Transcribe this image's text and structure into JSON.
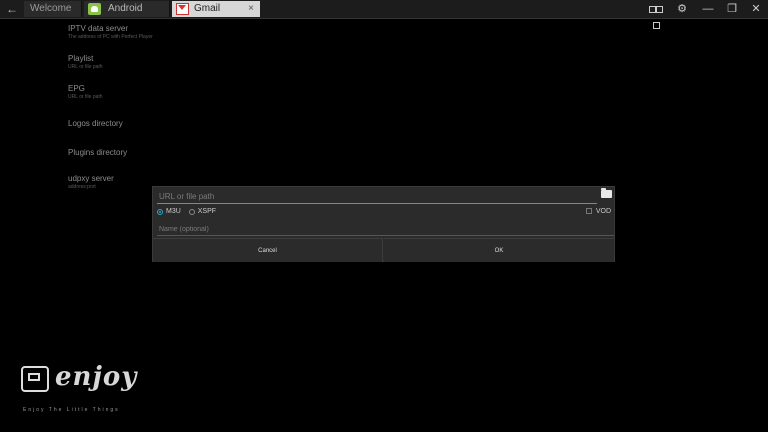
{
  "titlebar": {
    "tabs": [
      {
        "label": "Welcome"
      },
      {
        "label": "Android"
      },
      {
        "label": "Gmail",
        "close": "×"
      }
    ],
    "back": "←",
    "icons": {
      "gear": "⚙",
      "minimize": "—",
      "restore": "❐",
      "close": "✕"
    }
  },
  "settings": [
    {
      "title": "IPTV data server",
      "sub": "The address of PC with Perfect Player"
    },
    {
      "title": "Playlist",
      "sub": "URL or file path"
    },
    {
      "title": "EPG",
      "sub": "URL or file path"
    },
    {
      "title": "Logos directory",
      "sub": ""
    },
    {
      "title": "Plugins directory",
      "sub": ""
    },
    {
      "title": "udpxy server",
      "sub": "address:port"
    }
  ],
  "dialog": {
    "url_placeholder": "URL or file path",
    "radio_m3u": "M3U",
    "radio_xspf": "XSPF",
    "vod_label": "VOD",
    "name_placeholder": "Name (optional)",
    "cancel_label": "Cancel",
    "ok_label": "OK",
    "accent_color": "#2aa8c7"
  },
  "watermark": {
    "brand": "enjoy",
    "tagline": "Enjoy The Little Things"
  }
}
